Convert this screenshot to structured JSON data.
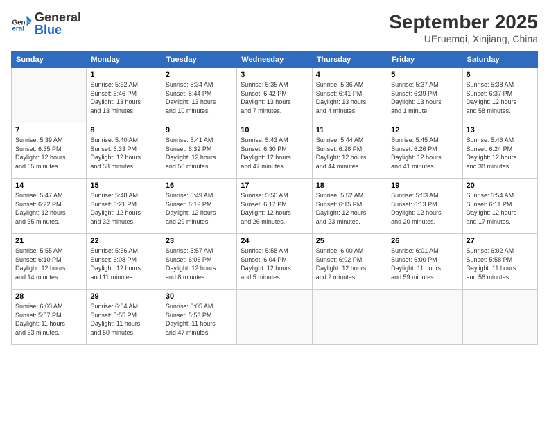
{
  "logo": {
    "general": "General",
    "blue": "Blue"
  },
  "title": "September 2025",
  "subtitle": "UEruemqi, Xinjiang, China",
  "days_of_week": [
    "Sunday",
    "Monday",
    "Tuesday",
    "Wednesday",
    "Thursday",
    "Friday",
    "Saturday"
  ],
  "weeks": [
    [
      {
        "day": "",
        "info": ""
      },
      {
        "day": "1",
        "info": "Sunrise: 5:32 AM\nSunset: 6:46 PM\nDaylight: 13 hours\nand 13 minutes."
      },
      {
        "day": "2",
        "info": "Sunrise: 5:34 AM\nSunset: 6:44 PM\nDaylight: 13 hours\nand 10 minutes."
      },
      {
        "day": "3",
        "info": "Sunrise: 5:35 AM\nSunset: 6:42 PM\nDaylight: 13 hours\nand 7 minutes."
      },
      {
        "day": "4",
        "info": "Sunrise: 5:36 AM\nSunset: 6:41 PM\nDaylight: 13 hours\nand 4 minutes."
      },
      {
        "day": "5",
        "info": "Sunrise: 5:37 AM\nSunset: 6:39 PM\nDaylight: 13 hours\nand 1 minute."
      },
      {
        "day": "6",
        "info": "Sunrise: 5:38 AM\nSunset: 6:37 PM\nDaylight: 12 hours\nand 58 minutes."
      }
    ],
    [
      {
        "day": "7",
        "info": "Sunrise: 5:39 AM\nSunset: 6:35 PM\nDaylight: 12 hours\nand 55 minutes."
      },
      {
        "day": "8",
        "info": "Sunrise: 5:40 AM\nSunset: 6:33 PM\nDaylight: 12 hours\nand 53 minutes."
      },
      {
        "day": "9",
        "info": "Sunrise: 5:41 AM\nSunset: 6:32 PM\nDaylight: 12 hours\nand 50 minutes."
      },
      {
        "day": "10",
        "info": "Sunrise: 5:43 AM\nSunset: 6:30 PM\nDaylight: 12 hours\nand 47 minutes."
      },
      {
        "day": "11",
        "info": "Sunrise: 5:44 AM\nSunset: 6:28 PM\nDaylight: 12 hours\nand 44 minutes."
      },
      {
        "day": "12",
        "info": "Sunrise: 5:45 AM\nSunset: 6:26 PM\nDaylight: 12 hours\nand 41 minutes."
      },
      {
        "day": "13",
        "info": "Sunrise: 5:46 AM\nSunset: 6:24 PM\nDaylight: 12 hours\nand 38 minutes."
      }
    ],
    [
      {
        "day": "14",
        "info": "Sunrise: 5:47 AM\nSunset: 6:22 PM\nDaylight: 12 hours\nand 35 minutes."
      },
      {
        "day": "15",
        "info": "Sunrise: 5:48 AM\nSunset: 6:21 PM\nDaylight: 12 hours\nand 32 minutes."
      },
      {
        "day": "16",
        "info": "Sunrise: 5:49 AM\nSunset: 6:19 PM\nDaylight: 12 hours\nand 29 minutes."
      },
      {
        "day": "17",
        "info": "Sunrise: 5:50 AM\nSunset: 6:17 PM\nDaylight: 12 hours\nand 26 minutes."
      },
      {
        "day": "18",
        "info": "Sunrise: 5:52 AM\nSunset: 6:15 PM\nDaylight: 12 hours\nand 23 minutes."
      },
      {
        "day": "19",
        "info": "Sunrise: 5:53 AM\nSunset: 6:13 PM\nDaylight: 12 hours\nand 20 minutes."
      },
      {
        "day": "20",
        "info": "Sunrise: 5:54 AM\nSunset: 6:11 PM\nDaylight: 12 hours\nand 17 minutes."
      }
    ],
    [
      {
        "day": "21",
        "info": "Sunrise: 5:55 AM\nSunset: 6:10 PM\nDaylight: 12 hours\nand 14 minutes."
      },
      {
        "day": "22",
        "info": "Sunrise: 5:56 AM\nSunset: 6:08 PM\nDaylight: 12 hours\nand 11 minutes."
      },
      {
        "day": "23",
        "info": "Sunrise: 5:57 AM\nSunset: 6:06 PM\nDaylight: 12 hours\nand 8 minutes."
      },
      {
        "day": "24",
        "info": "Sunrise: 5:58 AM\nSunset: 6:04 PM\nDaylight: 12 hours\nand 5 minutes."
      },
      {
        "day": "25",
        "info": "Sunrise: 6:00 AM\nSunset: 6:02 PM\nDaylight: 12 hours\nand 2 minutes."
      },
      {
        "day": "26",
        "info": "Sunrise: 6:01 AM\nSunset: 6:00 PM\nDaylight: 11 hours\nand 59 minutes."
      },
      {
        "day": "27",
        "info": "Sunrise: 6:02 AM\nSunset: 5:58 PM\nDaylight: 11 hours\nand 56 minutes."
      }
    ],
    [
      {
        "day": "28",
        "info": "Sunrise: 6:03 AM\nSunset: 5:57 PM\nDaylight: 11 hours\nand 53 minutes."
      },
      {
        "day": "29",
        "info": "Sunrise: 6:04 AM\nSunset: 5:55 PM\nDaylight: 11 hours\nand 50 minutes."
      },
      {
        "day": "30",
        "info": "Sunrise: 6:05 AM\nSunset: 5:53 PM\nDaylight: 11 hours\nand 47 minutes."
      },
      {
        "day": "",
        "info": ""
      },
      {
        "day": "",
        "info": ""
      },
      {
        "day": "",
        "info": ""
      },
      {
        "day": "",
        "info": ""
      }
    ]
  ]
}
